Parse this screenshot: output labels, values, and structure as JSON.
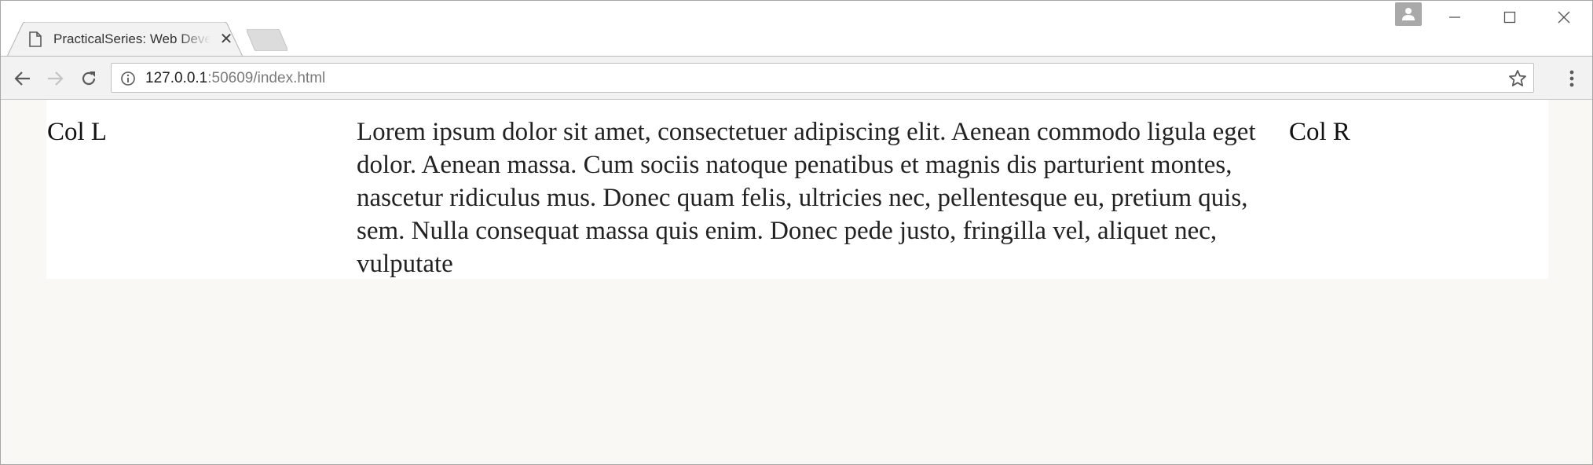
{
  "browser": {
    "tab": {
      "title": "PracticalSeries: Web Development",
      "close_glyph": "✕"
    },
    "address_bar": {
      "url_host": "127.0.0.1",
      "url_rest": ":50609/index.html"
    },
    "icons": {
      "page": "page-icon",
      "back": "arrow-left-icon",
      "forward": "arrow-right-icon",
      "reload": "reload-icon",
      "info": "info-icon",
      "bookmark": "star-icon",
      "menu": "kebab-menu-icon",
      "profile": "person-icon",
      "minimize": "minimize-icon",
      "maximize": "maximize-icon",
      "close": "close-icon"
    }
  },
  "page": {
    "col_left": "Col L",
    "col_main": "Lorem ipsum dolor sit amet, consectetuer adipiscing elit. Aenean commodo ligula eget dolor. Aenean massa. Cum sociis natoque penatibus et magnis dis parturient montes, nascetur ridiculus mus. Donec quam felis, ultricies nec, pellentesque eu, pretium quis, sem. Nulla consequat massa quis enim. Donec pede justo, fringilla vel, aliquet nec, vulputate",
    "col_right": "Col R"
  },
  "colors": {
    "page_background": "#f9f8f5",
    "content_background": "#ffffff",
    "toolbar": "#f2f2f2",
    "text": "#222222"
  }
}
